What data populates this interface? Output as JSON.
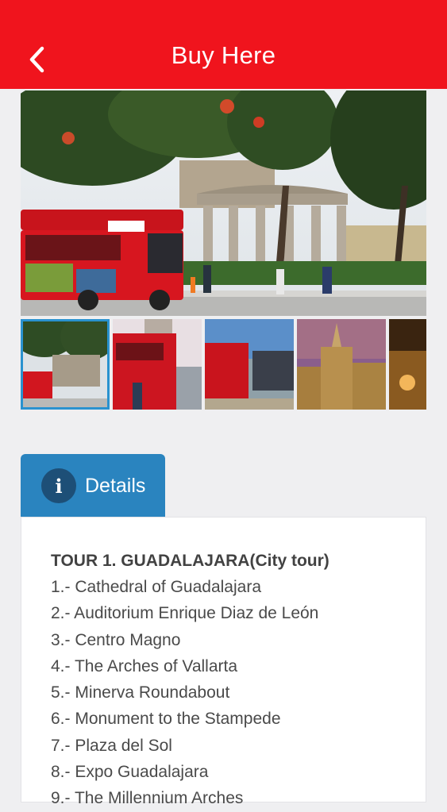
{
  "header": {
    "title": "Buy Here",
    "back_icon": "chevron-left-icon",
    "background": "#f0141d"
  },
  "gallery": {
    "thumbnail_count": 5,
    "selected_index": 0,
    "accent": "#2a92cf"
  },
  "details": {
    "tab_label": "Details",
    "tab_icon": "info-icon",
    "tab_color": "#2a84bf",
    "tour_title": "TOUR 1. GUADALAJARA(City tour)",
    "stops": [
      "1.- Cathedral of Guadalajara",
      "2.- Auditorium Enrique Diaz de León",
      "3.- Centro Magno",
      "4.- The Arches of Vallarta",
      "5.- Minerva Roundabout",
      "6.- Monument to the Stampede",
      "7.- Plaza del Sol",
      "8.- Expo Guadalajara",
      "9.- The Millennium Arches"
    ]
  }
}
